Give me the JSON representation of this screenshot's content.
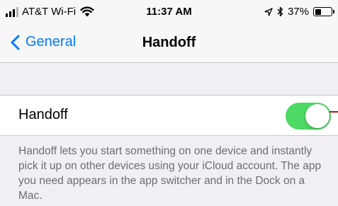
{
  "status_bar": {
    "carrier": "AT&T Wi-Fi",
    "time": "11:37 AM",
    "battery": "37%",
    "battery_level": 0.37,
    "signal_bars_active": 3,
    "signal_bars_total": 4,
    "icons": [
      "signal-icon",
      "wifi-icon",
      "location-icon",
      "bluetooth-icon",
      "battery-icon"
    ]
  },
  "nav": {
    "back_label": "General",
    "title": "Handoff"
  },
  "settings": {
    "handoff_label": "Handoff",
    "handoff_enabled": true,
    "toggle_color": "#4cd964",
    "description": "Handoff lets you start something on one device and instantly pick it up on other devices using your iCloud account. The app you need appears in the app switcher and in the Dock on a Mac."
  },
  "colors": {
    "accent": "#007aff",
    "background": "#efeff4",
    "footer_text": "#6d6d72"
  }
}
